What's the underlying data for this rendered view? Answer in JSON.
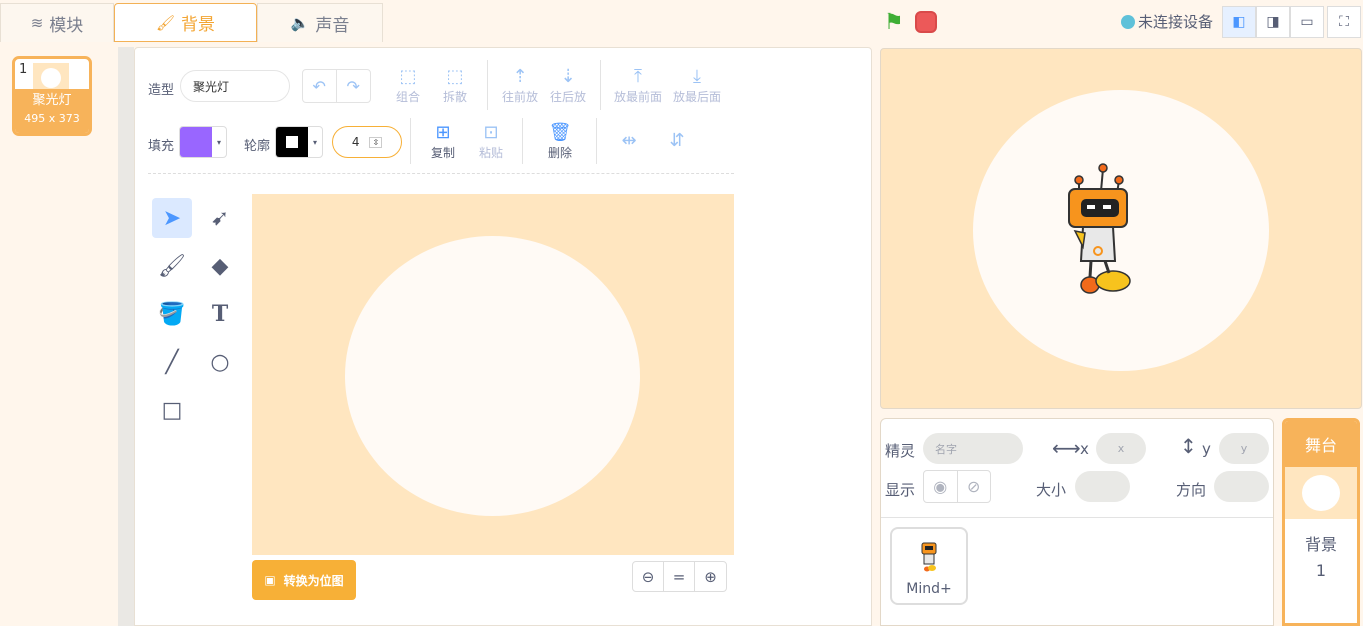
{
  "tabs": [
    {
      "label": "模块",
      "icon": "blocks-icon"
    },
    {
      "label": "背景",
      "icon": "paintbrush-icon"
    },
    {
      "label": "声音",
      "icon": "speaker-icon"
    }
  ],
  "costume": {
    "number": "1",
    "name": "聚光灯",
    "size": "495 x 373"
  },
  "toolbar": {
    "costume_label": "造型",
    "costume_name": "聚光灯",
    "group": "组合",
    "ungroup": "拆散",
    "forward": "往前放",
    "backward": "往后放",
    "front": "放最前面",
    "back": "放最后面",
    "fill_label": "填充",
    "outline_label": "轮廓",
    "outline_width": "4",
    "copy": "复制",
    "paste": "粘贴",
    "delete": "删除"
  },
  "colors": {
    "fill": "#9966ff",
    "outline": "#000000",
    "accent": "#f7b037",
    "backdrop": "#ffe6c0"
  },
  "convert_button": "转换为位图",
  "zoom": {
    "out": "⊖",
    "reset": "=",
    "in": "⊕"
  },
  "device_status": "未连接设备",
  "sprite_info": {
    "sprite_label": "精灵",
    "name_placeholder": "名字",
    "x_label": "x",
    "x_placeholder": "x",
    "y_label": "y",
    "y_placeholder": "y",
    "show_label": "显示",
    "size_label": "大小",
    "direction_label": "方向"
  },
  "sprites": [
    {
      "name": "Mind+"
    }
  ],
  "stage_panel": {
    "title": "舞台",
    "backdrop_label": "背景",
    "backdrop_count": "1"
  }
}
